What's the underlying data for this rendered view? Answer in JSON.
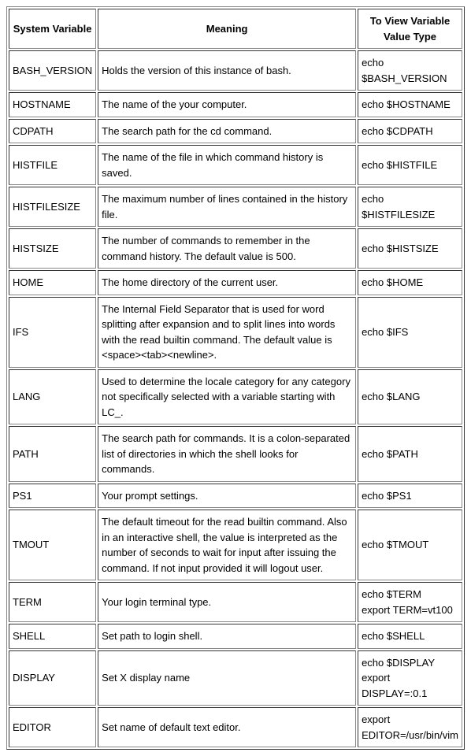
{
  "columns": [
    "System Variable",
    "Meaning",
    "To View Variable Value Type"
  ],
  "rows": [
    {
      "var": "BASH_VERSION",
      "meaning": "Holds the version of this instance of bash.",
      "view": "echo $BASH_VERSION"
    },
    {
      "var": "HOSTNAME",
      "meaning": "The name of the your computer.",
      "view": "echo $HOSTNAME"
    },
    {
      "var": "CDPATH",
      "meaning": "The search path for the cd command.",
      "view": "echo $CDPATH"
    },
    {
      "var": "HISTFILE",
      "meaning": "The name of the file in which command history is saved.",
      "view": "echo $HISTFILE"
    },
    {
      "var": "HISTFILESIZE",
      "meaning": "The maximum number of lines contained in the history file.",
      "view": "echo $HISTFILESIZE"
    },
    {
      "var": "HISTSIZE",
      "meaning": "The number of commands to remember in the command history. The default value is 500.",
      "view": "echo $HISTSIZE"
    },
    {
      "var": "HOME",
      "meaning": "The home directory of the current user.",
      "view": "echo $HOME"
    },
    {
      "var": "IFS",
      "meaning": "The Internal Field Separator that is used for word splitting after expansion and to split lines into words with the read builtin command. The default value is <space><tab><newline>.",
      "view": "echo $IFS"
    },
    {
      "var": "LANG",
      "meaning": "Used to determine the locale category for any category not specifically selected with a variable starting with LC_.",
      "view": "echo $LANG"
    },
    {
      "var": "PATH",
      "meaning": "The search path for commands. It is a colon-separated list of directories in which the shell looks for commands.",
      "view": "echo $PATH"
    },
    {
      "var": "PS1",
      "meaning": "Your prompt settings.",
      "view": "echo $PS1"
    },
    {
      "var": "TMOUT",
      "meaning": "The default timeout for the read builtin command. Also in an interactive shell, the value is interpreted as the number of seconds to wait for input after issuing the command. If not input provided it will logout user.",
      "view": "echo $TMOUT"
    },
    {
      "var": "TERM",
      "meaning": "Your login terminal type.",
      "view": "echo $TERM\nexport TERM=vt100"
    },
    {
      "var": "SHELL",
      "meaning": "Set path to login shell.",
      "view": "echo $SHELL"
    },
    {
      "var": "DISPLAY",
      "meaning": "Set X display name",
      "view": "echo $DISPLAY\nexport DISPLAY=:0.1"
    },
    {
      "var": "EDITOR",
      "meaning": "Set name of default text editor.",
      "view": "export EDITOR=/usr/bin/vim"
    }
  ]
}
